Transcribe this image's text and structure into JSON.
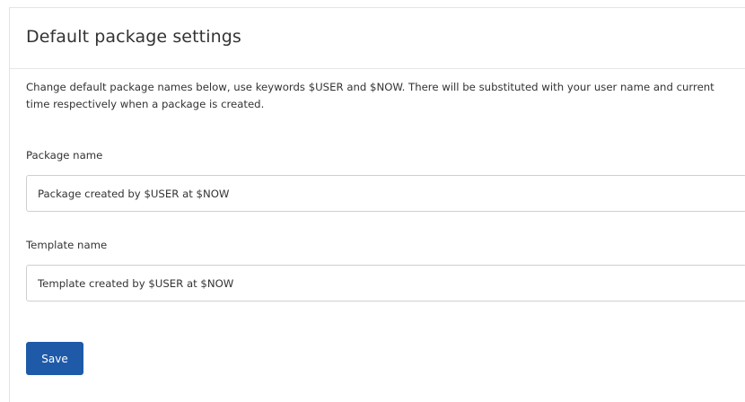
{
  "panel": {
    "title": "Default package settings",
    "description": "Change default package names below, use keywords $USER and $NOW. There will be substituted with your user name and current time respectively when a package is created."
  },
  "fields": {
    "package_name": {
      "label": "Package name",
      "value": "Package created by $USER at $NOW"
    },
    "template_name": {
      "label": "Template name",
      "value": "Template created by $USER at $NOW"
    }
  },
  "actions": {
    "save_label": "Save"
  },
  "colors": {
    "primary_button": "#1e5aa8",
    "text": "#333333",
    "border": "#cfcfcf"
  }
}
